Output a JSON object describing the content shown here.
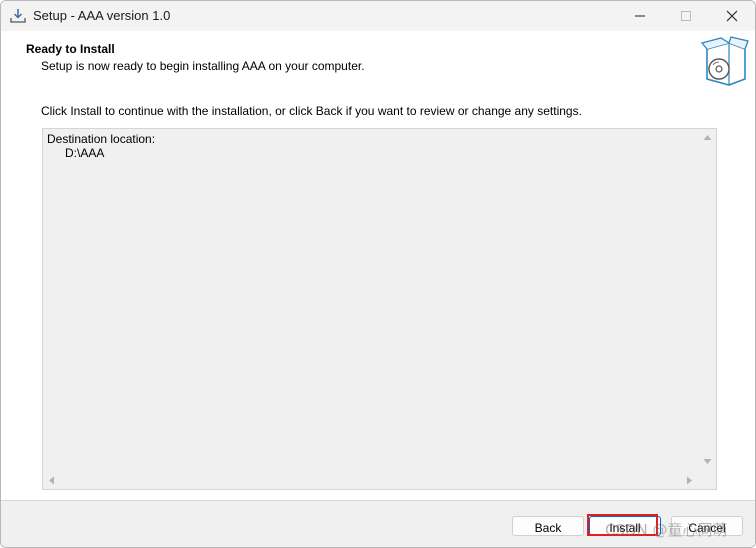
{
  "window": {
    "title": "Setup - AAA version 1.0"
  },
  "header": {
    "title": "Ready to Install",
    "subtitle": "Setup is now ready to begin installing AAA on your computer."
  },
  "instruction": "Click Install to continue with the installation, or click Back if you want to review or change any settings.",
  "memo": {
    "label": "Destination location:",
    "path": "D:\\AAA"
  },
  "buttons": {
    "back": "Back",
    "install": "Install",
    "cancel": "Cancel"
  },
  "watermark": "CSDN @童心同萌",
  "colors": {
    "highlight": "#e02020",
    "accent": "#0067c0"
  },
  "icons": {
    "title": "setup-download-icon",
    "header": "software-box-disc-icon"
  }
}
